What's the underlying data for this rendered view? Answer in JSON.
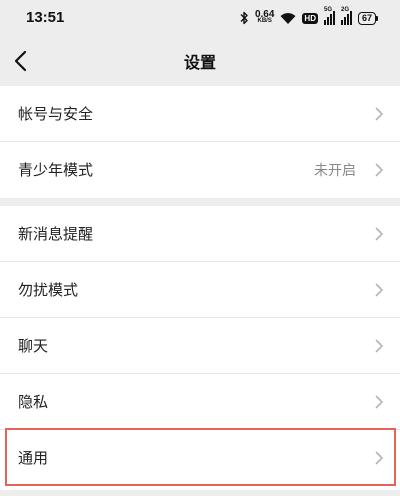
{
  "status_bar": {
    "time": "13:51",
    "net_speed_value": "0.64",
    "net_speed_unit": "KB/S",
    "hd_label": "HD",
    "signal1_tag": "5G",
    "signal2_tag": "2G",
    "battery": "67"
  },
  "nav": {
    "title": "设置",
    "back_icon": "chevron-left-icon"
  },
  "groups": [
    {
      "items": [
        {
          "label": "帐号与安全",
          "value": ""
        },
        {
          "label": "青少年模式",
          "value": "未开启"
        }
      ]
    },
    {
      "items": [
        {
          "label": "新消息提醒",
          "value": ""
        },
        {
          "label": "勿扰模式",
          "value": ""
        },
        {
          "label": "聊天",
          "value": ""
        },
        {
          "label": "隐私",
          "value": ""
        },
        {
          "label": "通用",
          "value": ""
        }
      ]
    }
  ],
  "highlight_color": "#e8625c",
  "chevron_icon": "chevron-right-icon"
}
